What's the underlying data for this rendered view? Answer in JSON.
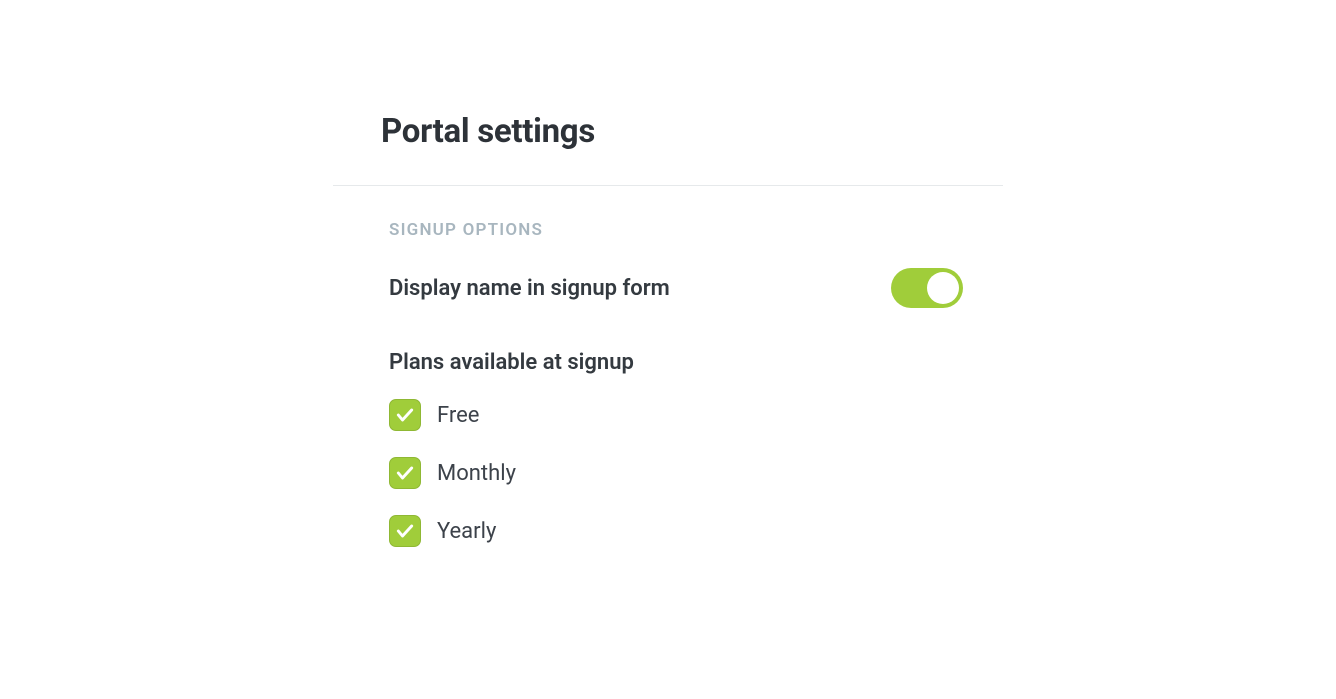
{
  "page": {
    "title": "Portal settings"
  },
  "signup": {
    "section_heading": "SIGNUP OPTIONS",
    "display_name_label": "Display name in signup form",
    "display_name_enabled": true,
    "plans_heading": "Plans available at signup",
    "plans": [
      {
        "label": "Free",
        "checked": true
      },
      {
        "label": "Monthly",
        "checked": true
      },
      {
        "label": "Yearly",
        "checked": true
      }
    ]
  },
  "colors": {
    "accent": "#a0cd3a"
  }
}
